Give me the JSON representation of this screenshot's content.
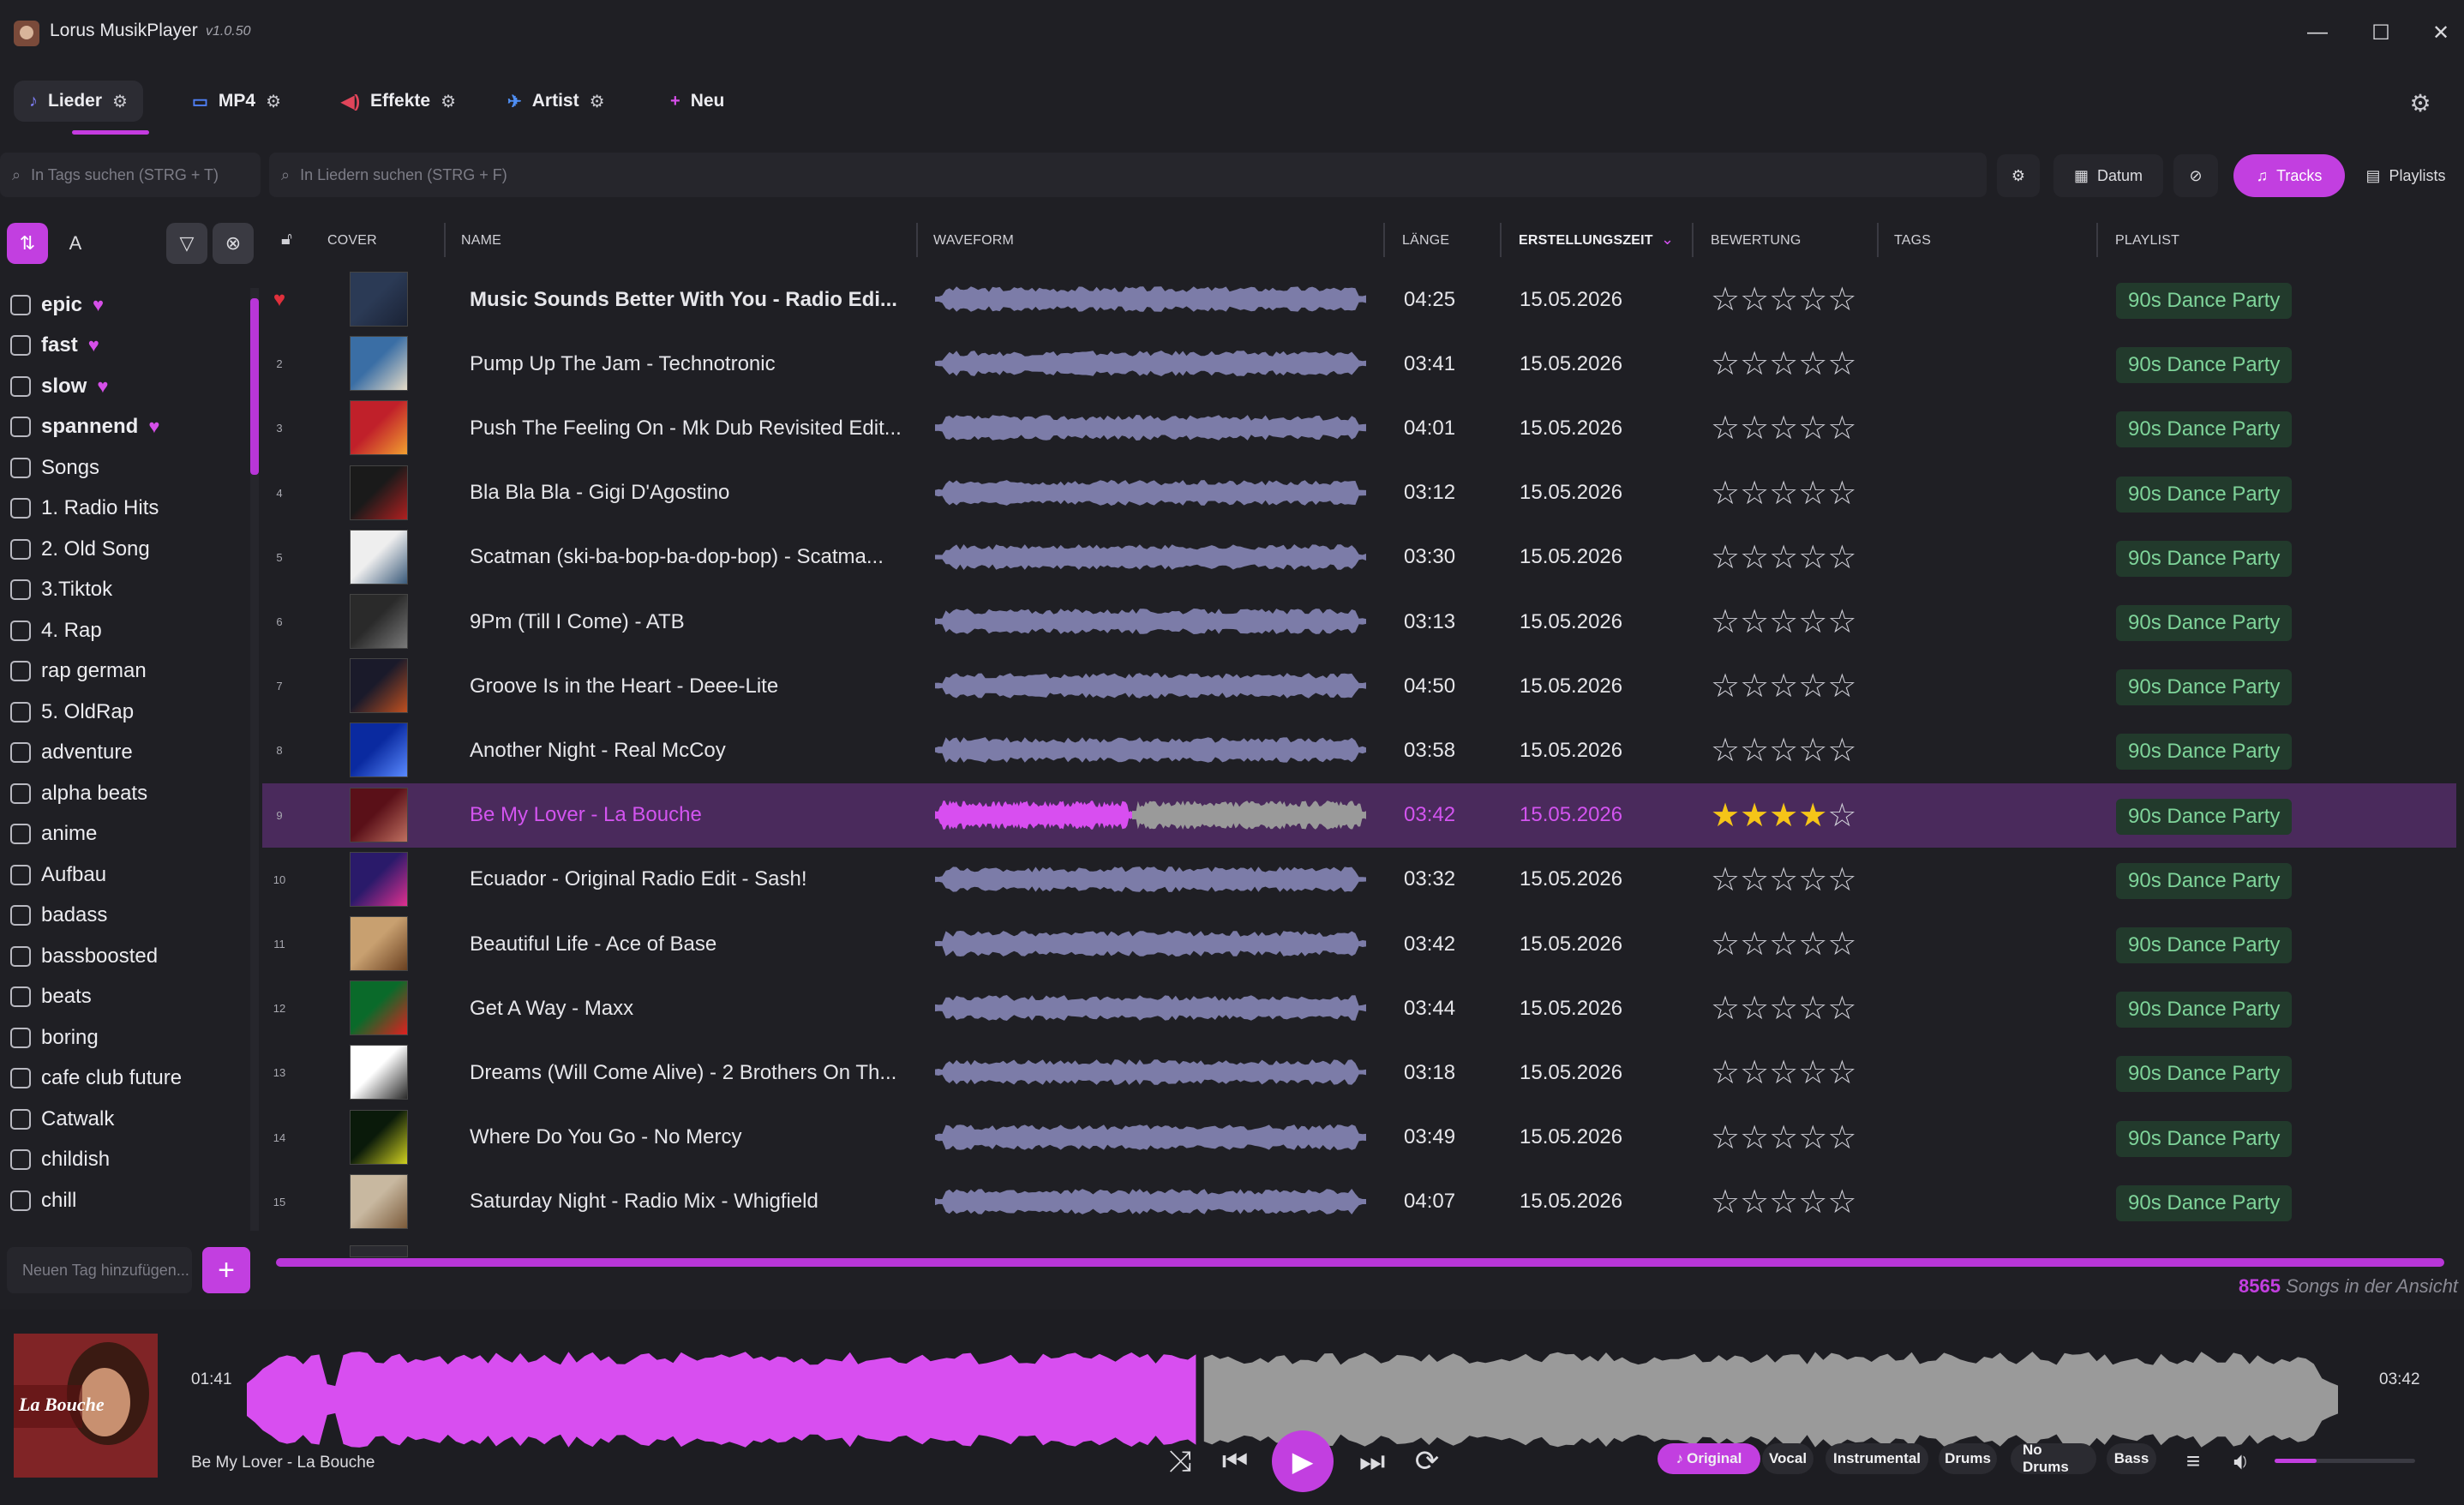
{
  "window": {
    "title": "Lorus MusikPlayer",
    "version": "v1.0.50"
  },
  "tabs": [
    {
      "label": "Lieder",
      "icon": "music-note-icon"
    },
    {
      "label": "MP4",
      "icon": "video-icon"
    },
    {
      "label": "Effekte",
      "icon": "speaker-icon"
    },
    {
      "label": "Artist",
      "icon": "plane-icon"
    },
    {
      "label": "Neu",
      "icon": "plus-icon"
    }
  ],
  "search": {
    "tags_placeholder": "In Tags suchen (STRG + T)",
    "songs_placeholder": "In Liedern suchen (STRG + F)"
  },
  "toolbar": {
    "date_label": "Datum",
    "tracks_label": "Tracks",
    "playlists_label": "Playlists"
  },
  "sidebar": {
    "tags": [
      {
        "label": "epic",
        "fav": true
      },
      {
        "label": "fast",
        "fav": true
      },
      {
        "label": "slow",
        "fav": true
      },
      {
        "label": "spannend",
        "fav": true
      },
      {
        "label": "Songs"
      },
      {
        "label": "1. Radio Hits"
      },
      {
        "label": "2. Old Song"
      },
      {
        "label": "3.Tiktok"
      },
      {
        "label": "4. Rap"
      },
      {
        "label": "rap german"
      },
      {
        "label": "5. OldRap"
      },
      {
        "label": "adventure"
      },
      {
        "label": "alpha beats"
      },
      {
        "label": "anime"
      },
      {
        "label": "Aufbau"
      },
      {
        "label": "badass"
      },
      {
        "label": "bassboosted"
      },
      {
        "label": "beats"
      },
      {
        "label": "boring"
      },
      {
        "label": "cafe club future"
      },
      {
        "label": "Catwalk"
      },
      {
        "label": "childish"
      },
      {
        "label": "chill"
      }
    ],
    "new_tag_placeholder": "Neuen Tag hinzufügen..."
  },
  "table": {
    "headers": {
      "cover": "COVER",
      "name": "NAME",
      "waveform": "WAVEFORM",
      "length": "LÄNGE",
      "created": "ERSTELLUNGSZEIT",
      "rating": "BEWERTUNG",
      "tags": "TAGS",
      "playlist": "PLAYLIST"
    },
    "rows": [
      {
        "num": "",
        "name": "Music Sounds Better With You - Radio Edi...",
        "length": "04:25",
        "date": "15.05.2026",
        "rating": 0,
        "playlist": "90s Dance Party",
        "fav": true
      },
      {
        "num": "2",
        "name": "Pump Up The Jam - Technotronic",
        "length": "03:41",
        "date": "15.05.2026",
        "rating": 0,
        "playlist": "90s Dance Party"
      },
      {
        "num": "3",
        "name": "Push The Feeling On - Mk Dub Revisited Edit...",
        "length": "04:01",
        "date": "15.05.2026",
        "rating": 0,
        "playlist": "90s Dance Party"
      },
      {
        "num": "4",
        "name": "Bla Bla Bla - Gigi D'Agostino",
        "length": "03:12",
        "date": "15.05.2026",
        "rating": 0,
        "playlist": "90s Dance Party"
      },
      {
        "num": "5",
        "name": "Scatman (ski-ba-bop-ba-dop-bop) - Scatma...",
        "length": "03:30",
        "date": "15.05.2026",
        "rating": 0,
        "playlist": "90s Dance Party"
      },
      {
        "num": "6",
        "name": "9Pm (Till I Come) - ATB",
        "length": "03:13",
        "date": "15.05.2026",
        "rating": 0,
        "playlist": "90s Dance Party"
      },
      {
        "num": "7",
        "name": "Groove Is in the Heart - Deee-Lite",
        "length": "04:50",
        "date": "15.05.2026",
        "rating": 0,
        "playlist": "90s Dance Party"
      },
      {
        "num": "8",
        "name": "Another Night - Real McCoy",
        "length": "03:58",
        "date": "15.05.2026",
        "rating": 0,
        "playlist": "90s Dance Party"
      },
      {
        "num": "9",
        "name": "Be My Lover - La Bouche",
        "length": "03:42",
        "date": "15.05.2026",
        "rating": 4,
        "playlist": "90s Dance Party",
        "active": true
      },
      {
        "num": "10",
        "name": "Ecuador - Original Radio Edit - Sash!",
        "length": "03:32",
        "date": "15.05.2026",
        "rating": 0,
        "playlist": "90s Dance Party"
      },
      {
        "num": "11",
        "name": "Beautiful Life - Ace of Base",
        "length": "03:42",
        "date": "15.05.2026",
        "rating": 0,
        "playlist": "90s Dance Party"
      },
      {
        "num": "12",
        "name": "Get A Way - Maxx",
        "length": "03:44",
        "date": "15.05.2026",
        "rating": 0,
        "playlist": "90s Dance Party"
      },
      {
        "num": "13",
        "name": "Dreams (Will Come Alive) - 2 Brothers On Th...",
        "length": "03:18",
        "date": "15.05.2026",
        "rating": 0,
        "playlist": "90s Dance Party"
      },
      {
        "num": "14",
        "name": "Where Do You Go - No Mercy",
        "length": "03:49",
        "date": "15.05.2026",
        "rating": 0,
        "playlist": "90s Dance Party"
      },
      {
        "num": "15",
        "name": "Saturday Night - Radio Mix - Whigfield",
        "length": "04:07",
        "date": "15.05.2026",
        "rating": 0,
        "playlist": "90s Dance Party"
      }
    ],
    "count": "8565",
    "count_suffix": "Songs in der Ansicht"
  },
  "player": {
    "title": "Be My Lover - La Bouche",
    "elapsed": "01:41",
    "total": "03:42",
    "progress": 0.455,
    "volume": 0.3,
    "stems": [
      "Original",
      "Vocal",
      "Instrumental",
      "Drums",
      "No Drums",
      "Bass"
    ],
    "cover_text": "La Bouche"
  },
  "colors": {
    "accent": "#c23fe0",
    "waveform": "#7c7ca8",
    "waveform_played": "#d84ef0",
    "waveform_rest": "#9a9a9a",
    "playlist_text": "#7fd49a"
  }
}
